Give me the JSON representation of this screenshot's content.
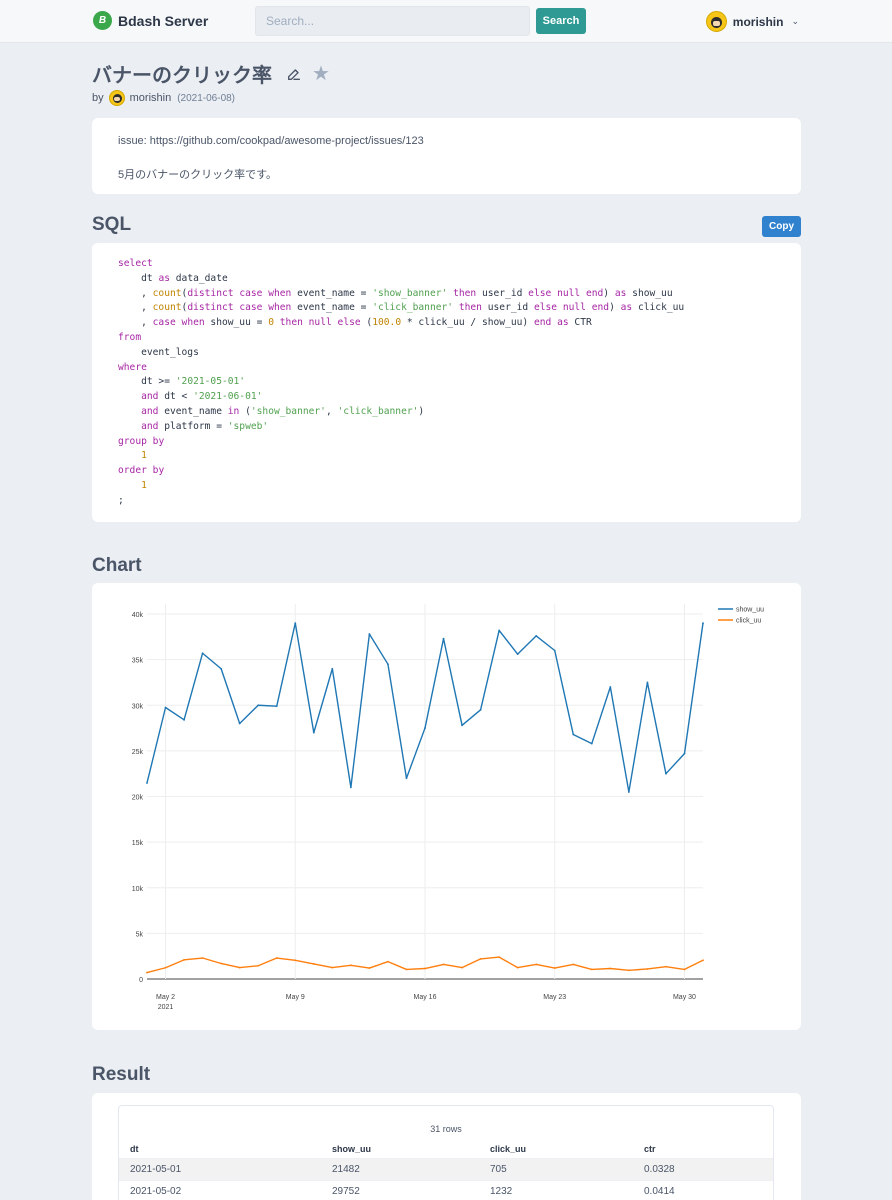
{
  "header": {
    "brand_logo": "B",
    "brand_name": "Bdash Server",
    "search_placeholder": "Search...",
    "search_button": "Search",
    "user_name": "morishin",
    "chevron": "⌄"
  },
  "query": {
    "title": "バナーのクリック率",
    "by_label": "by",
    "author": "morishin",
    "date": "(2021-06-08)",
    "description": [
      "issue: https://github.com/cookpad/awesome-project/issues/123",
      "5月のバナーのクリック率です。"
    ]
  },
  "sql": {
    "heading": "SQL",
    "copy_label": "Copy",
    "lines": [
      "select",
      "    dt as data_date",
      "    , count(distinct case when event_name = 'show_banner' then user_id else null end) as show_uu",
      "    , count(distinct case when event_name = 'click_banner' then user_id else null end) as click_uu",
      "    , case when show_uu = 0 then null else (100.0 * click_uu / show_uu) end as CTR",
      "from",
      "    event_logs",
      "where",
      "    dt >= '2021-05-01'",
      "    and dt < '2021-06-01'",
      "    and event_name in ('show_banner', 'click_banner')",
      "    and platform = 'spweb'",
      "group by",
      "    1",
      "order by",
      "    1",
      ";"
    ]
  },
  "chart_section": {
    "heading": "Chart"
  },
  "chart_data": {
    "type": "line",
    "x": [
      "2021-05-01",
      "2021-05-02",
      "2021-05-03",
      "2021-05-04",
      "2021-05-05",
      "2021-05-06",
      "2021-05-07",
      "2021-05-08",
      "2021-05-09",
      "2021-05-10",
      "2021-05-11",
      "2021-05-12",
      "2021-05-13",
      "2021-05-14",
      "2021-05-15",
      "2021-05-16",
      "2021-05-17",
      "2021-05-18",
      "2021-05-19",
      "2021-05-20",
      "2021-05-21",
      "2021-05-22",
      "2021-05-23",
      "2021-05-24",
      "2021-05-25",
      "2021-05-26",
      "2021-05-27",
      "2021-05-28",
      "2021-05-29",
      "2021-05-30",
      "2021-05-31"
    ],
    "series": [
      {
        "name": "show_uu",
        "color": "#1f77b4",
        "values": [
          21482,
          29752,
          28400,
          35700,
          34000,
          28000,
          30000,
          29900,
          39000,
          27000,
          34000,
          21000,
          37800,
          34500,
          22000,
          27500,
          37300,
          27800,
          29500,
          38200,
          35600,
          37600,
          36000,
          26800,
          25800,
          32000,
          20500,
          32500,
          22500,
          24700,
          39000
        ]
      },
      {
        "name": "click_uu",
        "color": "#ff7f0e",
        "values": [
          705,
          1232,
          2100,
          2300,
          1700,
          1250,
          1450,
          2300,
          2050,
          1650,
          1250,
          1500,
          1200,
          1900,
          1050,
          1150,
          1600,
          1250,
          2200,
          2400,
          1250,
          1600,
          1200,
          1600,
          1050,
          1150,
          950,
          1100,
          1350,
          1050,
          2050
        ]
      }
    ],
    "xticks": [
      {
        "date": "2021-05-02",
        "label": "May 2",
        "sub": "2021"
      },
      {
        "date": "2021-05-09",
        "label": "May 9"
      },
      {
        "date": "2021-05-16",
        "label": "May 16"
      },
      {
        "date": "2021-05-23",
        "label": "May 23"
      },
      {
        "date": "2021-05-30",
        "label": "May 30"
      }
    ],
    "yticks": [
      0,
      5000,
      10000,
      15000,
      20000,
      25000,
      30000,
      35000,
      40000
    ],
    "ytick_labels": [
      "0",
      "5k",
      "10k",
      "15k",
      "20k",
      "25k",
      "30k",
      "35k",
      "40k"
    ],
    "ylim": [
      0,
      40000
    ],
    "grid": true,
    "legend": "top-right"
  },
  "result": {
    "heading": "Result",
    "rows_count": "31 rows",
    "columns": [
      "dt",
      "show_uu",
      "click_uu",
      "ctr"
    ],
    "rows": [
      [
        "2021-05-01",
        "21482",
        "705",
        "0.0328"
      ],
      [
        "2021-05-02",
        "29752",
        "1232",
        "0.0414"
      ]
    ]
  }
}
